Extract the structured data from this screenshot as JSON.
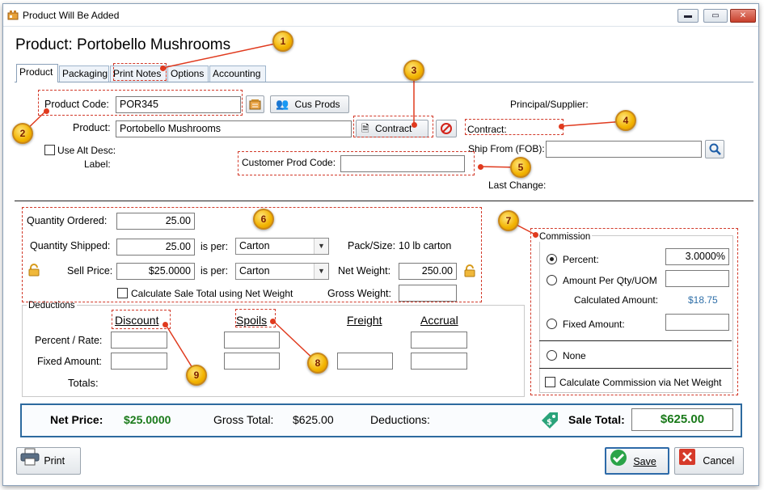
{
  "window": {
    "title": "Product Will Be Added",
    "minimize_icon": "minimize-icon",
    "maximize_icon": "maximize-icon",
    "close_icon": "close-icon"
  },
  "header": {
    "title": "Product: Portobello Mushrooms"
  },
  "tabs": [
    {
      "label": "Product",
      "active": true
    },
    {
      "label": "Packaging"
    },
    {
      "label": "Print Notes"
    },
    {
      "label": "Options"
    },
    {
      "label": "Accounting"
    }
  ],
  "product": {
    "code_label": "Product Code:",
    "code_value": "POR345",
    "cus_prods_label": "Cus Prods",
    "product_label": "Product:",
    "product_value": "Portobello Mushrooms",
    "contract_button": "Contract",
    "use_alt_desc_label": "Use Alt Desc:",
    "label_label": "Label:",
    "customer_prod_code_label": "Customer Prod Code:",
    "customer_prod_code_value": "",
    "principal_label": "Principal/Supplier:",
    "contract_label": "Contract:",
    "ship_from_label": "Ship From (FOB):",
    "ship_from_value": "",
    "last_change_label": "Last Change:"
  },
  "quantity": {
    "ordered_label": "Quantity Ordered:",
    "ordered_value": "25.00",
    "shipped_label": "Quantity Shipped:",
    "shipped_value": "25.00",
    "is_per_label": "is per:",
    "shipped_unit": "Carton",
    "pack_size_label": "Pack/Size:",
    "pack_size_value": "10 lb carton",
    "sell_price_label": "Sell Price:",
    "sell_price_value": "$25.0000",
    "sell_unit": "Carton",
    "net_weight_label": "Net Weight:",
    "net_weight_value": "250.00",
    "calc_net_weight_label": "Calculate Sale Total using Net Weight",
    "gross_weight_label": "Gross Weight:",
    "gross_weight_value": ""
  },
  "deductions": {
    "group_label": "Deductions",
    "columns": [
      "Discount",
      "Spoils",
      "Freight",
      "Accrual"
    ],
    "percent_rate_label": "Percent / Rate:",
    "fixed_amount_label": "Fixed Amount:",
    "totals_label": "Totals:"
  },
  "commission": {
    "group_label": "Commission",
    "percent_label": "Percent:",
    "percent_value": "3.0000%",
    "amount_per_qty_label": "Amount Per Qty/UOM",
    "amount_per_qty_value": "",
    "calculated_label": "Calculated Amount:",
    "calculated_value": "$18.75",
    "fixed_amount_label": "Fixed Amount:",
    "fixed_amount_value": "",
    "none_label": "None",
    "via_net_weight_label": "Calculate Commission via Net Weight",
    "selected": "percent"
  },
  "totals": {
    "net_price_label": "Net Price:",
    "net_price_value": "$25.0000",
    "gross_total_label": "Gross Total:",
    "gross_total_value": "$625.00",
    "deductions_label": "Deductions:",
    "sale_total_label": "Sale Total:",
    "sale_total_value": "$625.00"
  },
  "footer": {
    "print_label": "Print",
    "save_label": "Save",
    "cancel_label": "Cancel"
  },
  "callouts": [
    "1",
    "2",
    "3",
    "4",
    "5",
    "6",
    "7",
    "8",
    "9"
  ],
  "colors": {
    "accent_green": "#1a7a1a",
    "callout_red": "#d23a2a",
    "callout_gold": "#f2b300",
    "calculated_blue": "#2f6fa8",
    "totals_border": "#2d6a9f"
  }
}
